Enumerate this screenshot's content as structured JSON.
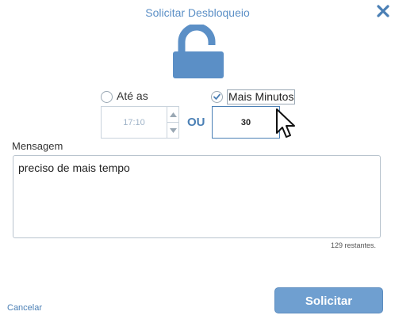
{
  "dialog": {
    "title": "Solicitar Desbloqueio",
    "close_icon": "close-icon",
    "lock_icon": "unlock-icon",
    "accent_color": "#5b8fc6"
  },
  "option_time": {
    "label": "Até as",
    "checked": false,
    "value": "17:10"
  },
  "separator": "OU",
  "option_minutes": {
    "label": "Mais Minutos",
    "checked": true,
    "value": "30"
  },
  "message": {
    "label": "Mensagem",
    "value": "preciso de mais tempo",
    "remaining": "129 restantes."
  },
  "footer": {
    "cancel_label": "Cancelar",
    "submit_label": "Solicitar"
  }
}
